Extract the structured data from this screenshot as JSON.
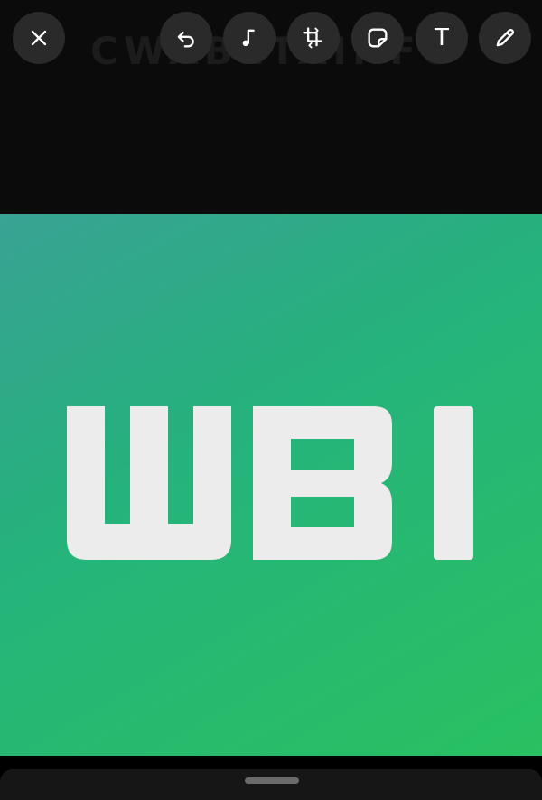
{
  "toolbar": {
    "close_icon": "close-icon",
    "undo_icon": "undo-icon",
    "music_icon": "music-note-icon",
    "crop_icon": "crop-rotate-icon",
    "sticker_icon": "sticker-icon",
    "text_label": "T",
    "pen_icon": "pencil-icon"
  },
  "watermark": {
    "text": "CWABETAINFO"
  },
  "image": {
    "logo_text": "WBI",
    "gradient_colors": [
      "#2f9e8f",
      "#25b47a",
      "#29c161"
    ],
    "logo_color": "#ececec"
  },
  "colors": {
    "background": "#000000",
    "button_background": "#2a2a2a",
    "icon": "#ffffff",
    "sheet": "#161616",
    "handle": "#6a6a6a"
  }
}
